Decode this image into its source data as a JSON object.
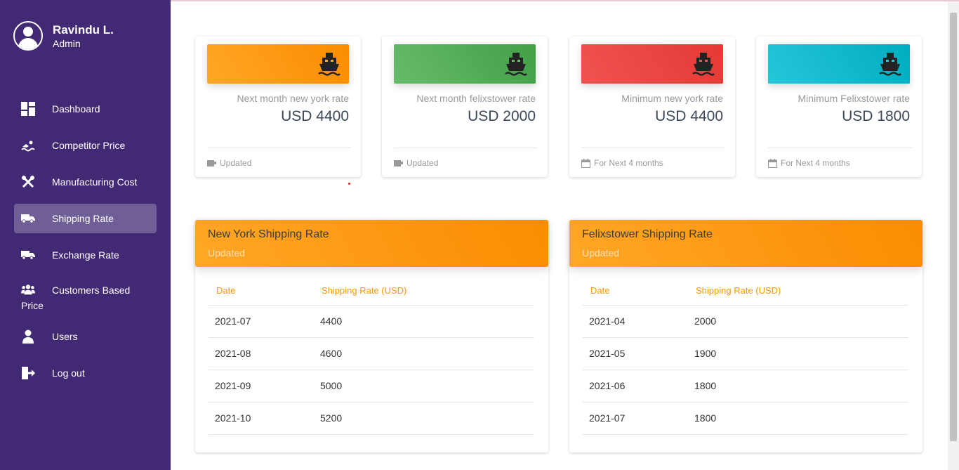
{
  "user": {
    "name": "Ravindu L.",
    "role": "Admin"
  },
  "sidebar": {
    "items": [
      {
        "label": "Dashboard",
        "icon": "dashboard-icon",
        "active": false
      },
      {
        "label": "Competitor Price",
        "icon": "swimmer-icon",
        "active": false
      },
      {
        "label": "Manufacturing Cost",
        "icon": "tools-icon",
        "active": false
      },
      {
        "label": "Shipping Rate",
        "icon": "truck-icon",
        "active": true
      },
      {
        "label": "Exchange Rate",
        "icon": "truck-icon",
        "active": false
      },
      {
        "label": "Customers Based Price",
        "icon": "users-icon",
        "active": false
      },
      {
        "label": "Users",
        "icon": "user-icon",
        "active": false
      },
      {
        "label": "Log out",
        "icon": "logout-icon",
        "active": false
      }
    ]
  },
  "stats": [
    {
      "title": "Next month new york rate",
      "value": "USD 4400",
      "footer": "Updated",
      "footer_icon": "coffee-icon",
      "color": "#fb8c00"
    },
    {
      "title": "Next month felixstower rate",
      "value": "USD 2000",
      "footer": "Updated",
      "footer_icon": "coffee-icon",
      "color": "#43a047"
    },
    {
      "title": "Minimum new york rate",
      "value": "USD 4400",
      "footer": "For Next 4 months",
      "footer_icon": "calendar-icon",
      "color": "#e53935"
    },
    {
      "title": "Minimum Felixstower rate",
      "value": "USD 1800",
      "footer": "For Next 4 months",
      "footer_icon": "calendar-icon",
      "color": "#00acc1"
    }
  ],
  "tables": [
    {
      "title": "New York Shipping Rate",
      "subtitle": "Updated",
      "headers": [
        "Date",
        "Shipping Rate (USD)"
      ],
      "rows": [
        [
          "2021-07",
          "4400"
        ],
        [
          "2021-08",
          "4600"
        ],
        [
          "2021-09",
          "5000"
        ],
        [
          "2021-10",
          "5200"
        ]
      ]
    },
    {
      "title": "Felixstower Shipping Rate",
      "subtitle": "Updated",
      "headers": [
        "Date",
        "Shipping Rate (USD)"
      ],
      "rows": [
        [
          "2021-04",
          "2000"
        ],
        [
          "2021-05",
          "1900"
        ],
        [
          "2021-06",
          "1800"
        ],
        [
          "2021-07",
          "1800"
        ]
      ]
    }
  ]
}
